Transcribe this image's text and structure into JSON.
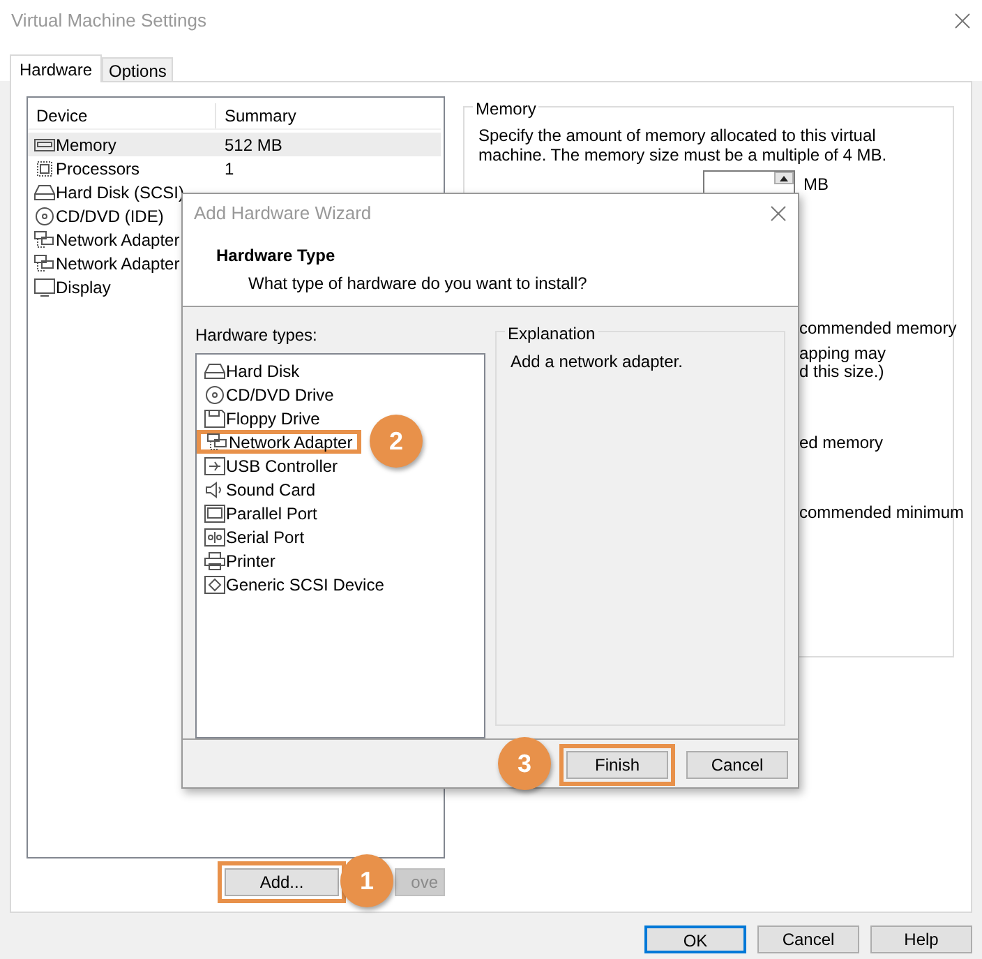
{
  "window": {
    "title": "Virtual Machine Settings"
  },
  "tabs": [
    {
      "label": "Hardware",
      "selected": true
    },
    {
      "label": "Options",
      "selected": false
    }
  ],
  "device_list": {
    "columns": [
      "Device",
      "Summary"
    ],
    "rows": [
      {
        "device": "Memory",
        "summary": "512 MB",
        "selected": true
      },
      {
        "device": "Processors",
        "summary": "1",
        "selected": false
      },
      {
        "device": "Hard Disk (SCSI)",
        "selected": false
      },
      {
        "device": "CD/DVD (IDE)",
        "selected": false
      },
      {
        "device": "Network Adapter",
        "selected": false
      },
      {
        "device": "Network Adapter",
        "selected": false
      },
      {
        "device": "Display",
        "selected": false
      }
    ]
  },
  "device_buttons": [
    {
      "label": "Add...",
      "disabled": false,
      "highlighted": true,
      "annotation": "1"
    },
    {
      "label": "ove",
      "disabled": true,
      "highlighted": false
    }
  ],
  "memory": {
    "title": "Memory",
    "description": "Specify the amount of memory allocated to this virtual machine. The memory size must be a multiple of 4 MB.",
    "unit": "MB",
    "notes": [
      "commended memory",
      "apping may",
      "d this size.)",
      "ed memory",
      "commended minimum"
    ]
  },
  "buttons": [
    {
      "label": "OK",
      "default": true
    },
    {
      "label": "Cancel",
      "default": false
    },
    {
      "label": "Help",
      "default": false
    }
  ],
  "wizard": {
    "title": "Add Hardware Wizard",
    "heading": "Hardware Type",
    "subheading": "What type of hardware do you want to install?",
    "list_label": "Hardware types:",
    "items": [
      {
        "label": "Hard Disk",
        "highlighted": false
      },
      {
        "label": "CD/DVD Drive",
        "highlighted": false
      },
      {
        "label": "Floppy Drive",
        "highlighted": false
      },
      {
        "label": "Network Adapter",
        "highlighted": true,
        "annotation": "2"
      },
      {
        "label": "USB Controller",
        "highlighted": false
      },
      {
        "label": "Sound Card",
        "highlighted": false
      },
      {
        "label": "Parallel Port",
        "highlighted": false
      },
      {
        "label": "Serial Port",
        "highlighted": false
      },
      {
        "label": "Printer",
        "highlighted": false
      },
      {
        "label": "Generic SCSI Device",
        "highlighted": false
      }
    ],
    "explanation": {
      "title": "Explanation",
      "text": "Add a network adapter."
    },
    "buttons": [
      {
        "label": "Finish",
        "highlighted": true,
        "annotation": "3"
      },
      {
        "label": "Cancel",
        "highlighted": false
      }
    ]
  }
}
